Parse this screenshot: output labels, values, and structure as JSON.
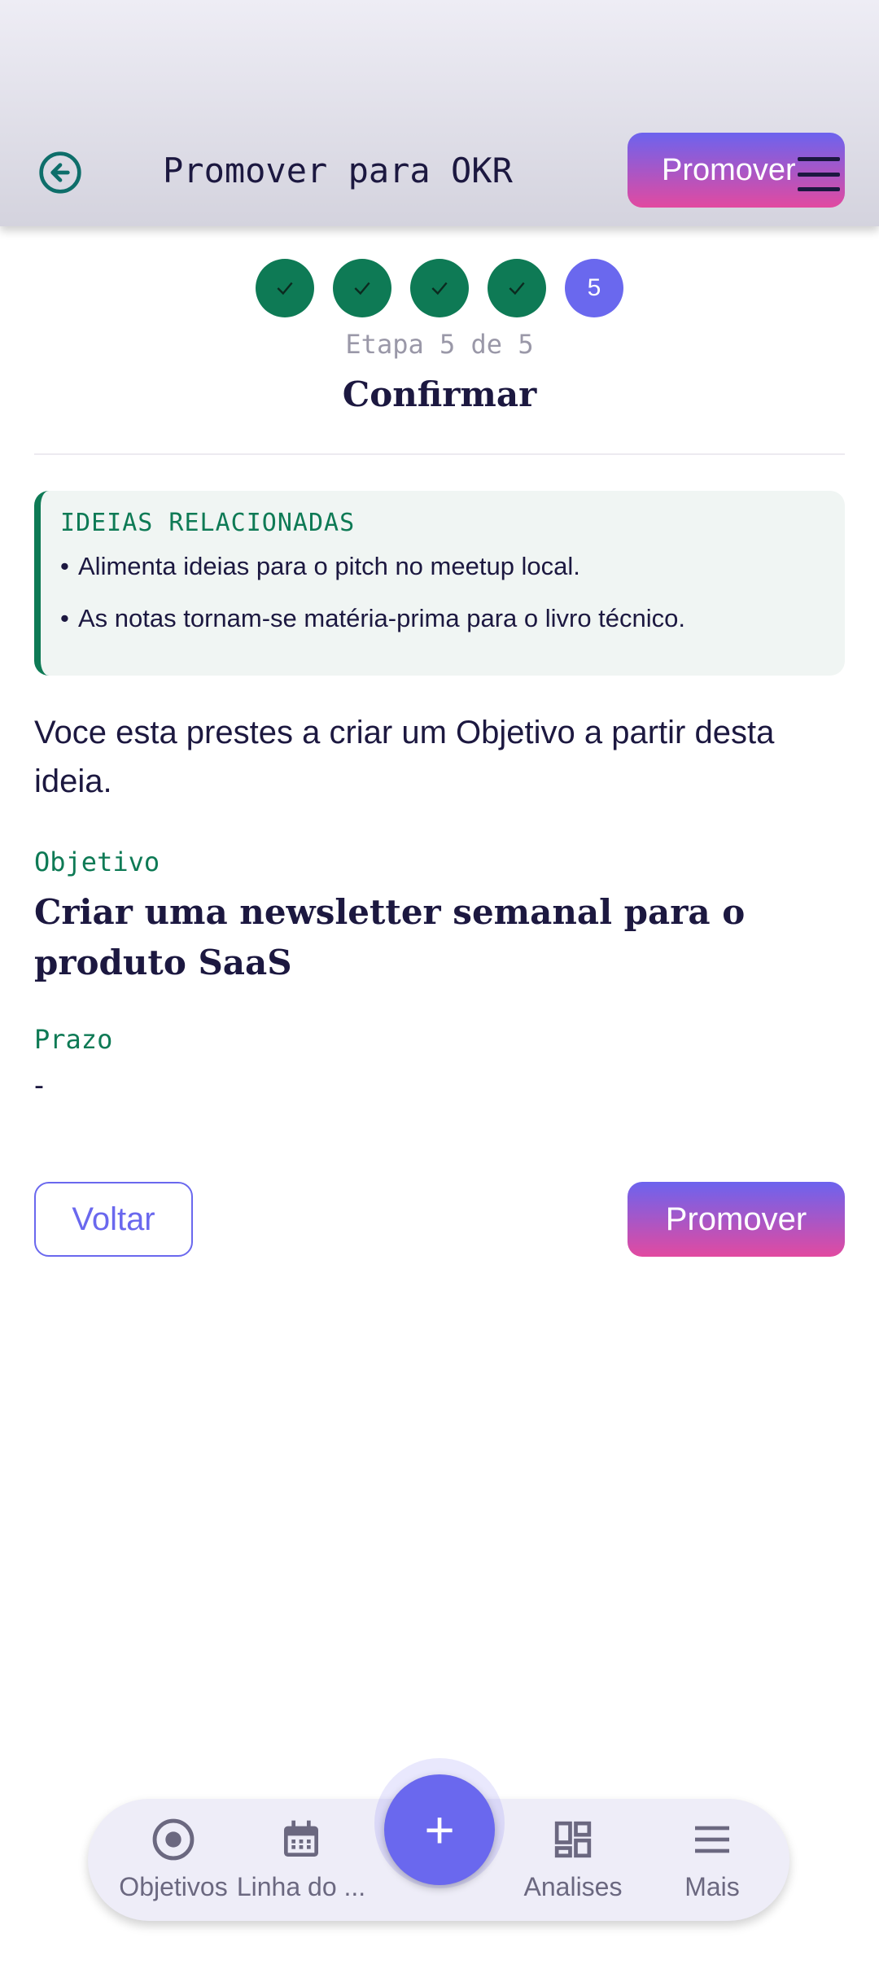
{
  "header": {
    "title": "Promover para OKR",
    "promote_label": "Promover"
  },
  "stepper": {
    "steps": [
      {
        "state": "done"
      },
      {
        "state": "done"
      },
      {
        "state": "done"
      },
      {
        "state": "done"
      },
      {
        "state": "current",
        "number": "5"
      }
    ],
    "caption": "Etapa 5 de 5",
    "title": "Confirmar"
  },
  "related": {
    "title": "IDEIAS RELACIONADAS",
    "items": [
      "Alimenta ideias para o pitch no meetup local.",
      "As notas tornam-se matéria-prima para o livro técnico."
    ]
  },
  "intro": "Voce esta prestes a criar um Objetivo a partir desta ideia.",
  "objective": {
    "label": "Objetivo",
    "value": "Criar uma newsletter semanal para o produto SaaS"
  },
  "deadline": {
    "label": "Prazo",
    "value": "-"
  },
  "actions": {
    "back_label": "Voltar",
    "promote_label": "Promover"
  },
  "bottom_nav": {
    "items": [
      {
        "label": "Objetivos",
        "icon": "target-icon"
      },
      {
        "label": "Linha do ...",
        "icon": "calendar-icon"
      },
      {
        "label": "Analises",
        "icon": "dashboard-icon"
      },
      {
        "label": "Mais",
        "icon": "menu-icon"
      }
    ],
    "fab_label": "+"
  },
  "colors": {
    "primary": "#6a68ee",
    "accent_green": "#0e7a55",
    "gradient_start": "#6c63ee",
    "gradient_end": "#e24aa0",
    "text": "#1c1840"
  }
}
